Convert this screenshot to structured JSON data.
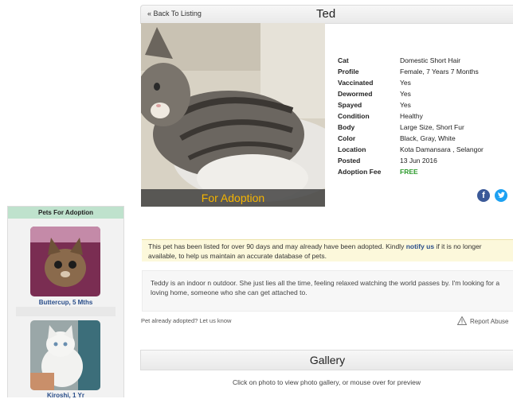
{
  "header": {
    "back_label": "« Back To Listing",
    "pet_name": "Ted"
  },
  "photo": {
    "banner": "For Adoption"
  },
  "details": [
    {
      "key": "Cat",
      "value": "Domestic Short Hair"
    },
    {
      "key": "Profile",
      "value": "Female, 7 Years 7 Months"
    },
    {
      "key": "Vaccinated",
      "value": "Yes"
    },
    {
      "key": "Dewormed",
      "value": "Yes"
    },
    {
      "key": "Spayed",
      "value": "Yes"
    },
    {
      "key": "Condition",
      "value": "Healthy"
    },
    {
      "key": "Body",
      "value": "Large Size, Short Fur"
    },
    {
      "key": "Color",
      "value": "Black, Gray, White"
    },
    {
      "key": "Location",
      "value": "Kota Damansara , Selangor"
    },
    {
      "key": "Posted",
      "value": "13 Jun 2016"
    },
    {
      "key": "Adoption Fee",
      "value": "FREE"
    }
  ],
  "share": {
    "facebook_icon": "facebook-icon",
    "twitter_icon": "twitter-icon",
    "colors": {
      "facebook": "#3b5998",
      "twitter": "#1da1f2"
    }
  },
  "sidebar": {
    "title": "Pets For Adoption",
    "items": [
      {
        "caption": "Buttercup, 5 Mths"
      },
      {
        "caption": "Kiroshi, 1 Yr"
      }
    ]
  },
  "notice": {
    "before": "This pet has been listed for over 90 days and may already have been adopted. Kindly ",
    "link": "notify us",
    "after": " if it is no longer available, to help us maintain an accurate database of pets."
  },
  "description": "Teddy is an indoor n outdoor. She just lies all the time, feeling relaxed watching the world passes by. I'm looking for a loving home, someone who she can get attached to.",
  "footer_links": {
    "adopted": "Pet already adopted? Let us know",
    "report": "Report Abuse"
  },
  "gallery": {
    "title": "Gallery",
    "note": "Click on photo to view photo gallery, or mouse over for preview"
  }
}
